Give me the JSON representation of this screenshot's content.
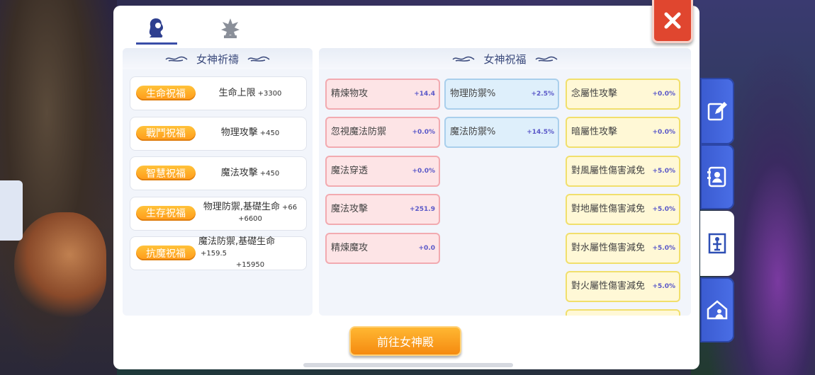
{
  "tabs": [
    {
      "icon": "goddess-portrait-icon",
      "active": true
    },
    {
      "icon": "emblem-icon",
      "active": false
    }
  ],
  "prayer": {
    "title": "女神祈禱",
    "items": [
      {
        "badge": "生命祝福",
        "desc": "生命上限",
        "value": "+3300",
        "line2": ""
      },
      {
        "badge": "戰鬥祝福",
        "desc": "物理攻擊",
        "value": "+450",
        "line2": ""
      },
      {
        "badge": "智慧祝福",
        "desc": "魔法攻擊",
        "value": "+450",
        "line2": ""
      },
      {
        "badge": "生存祝福",
        "desc": "物理防禦,基礎生命",
        "value": "+66",
        "line2": "+6600"
      },
      {
        "badge": "抗魔祝福",
        "desc": "魔法防禦,基礎生命",
        "value": "+159.5",
        "line2": "+15950"
      }
    ]
  },
  "blessing": {
    "title": "女神祝福",
    "col1": [
      {
        "name": "精煉物攻",
        "value": "+14.4"
      },
      {
        "name": "忽視魔法防禦",
        "value": "+0.0%"
      },
      {
        "name": "魔法穿透",
        "value": "+0.0%"
      },
      {
        "name": "魔法攻擊",
        "value": "+251.9"
      },
      {
        "name": "精煉魔攻",
        "value": "+0.0"
      }
    ],
    "col2": [
      {
        "name": "物理防禦%",
        "value": "+2.5%"
      },
      {
        "name": "魔法防禦%",
        "value": "+14.5%"
      }
    ],
    "col3": [
      {
        "name": "念屬性攻擊",
        "value": "+0.0%"
      },
      {
        "name": "暗屬性攻擊",
        "value": "+0.0%"
      },
      {
        "name": "對風屬性傷害減免",
        "value": "+5.0%"
      },
      {
        "name": "對地屬性傷害減免",
        "value": "+5.0%"
      },
      {
        "name": "對水屬性傷害減免",
        "value": "+5.0%"
      },
      {
        "name": "對火屬性傷害減免",
        "value": "+5.0%"
      }
    ]
  },
  "goto_button": "前往女神殿",
  "side_tabs": [
    "edit-icon",
    "contact-card-icon",
    "goddess-statue-icon",
    "guild-house-icon"
  ],
  "colors": {
    "accent": "#3a4ea8",
    "badge": "#ff9a18",
    "close": "#e0462f"
  }
}
